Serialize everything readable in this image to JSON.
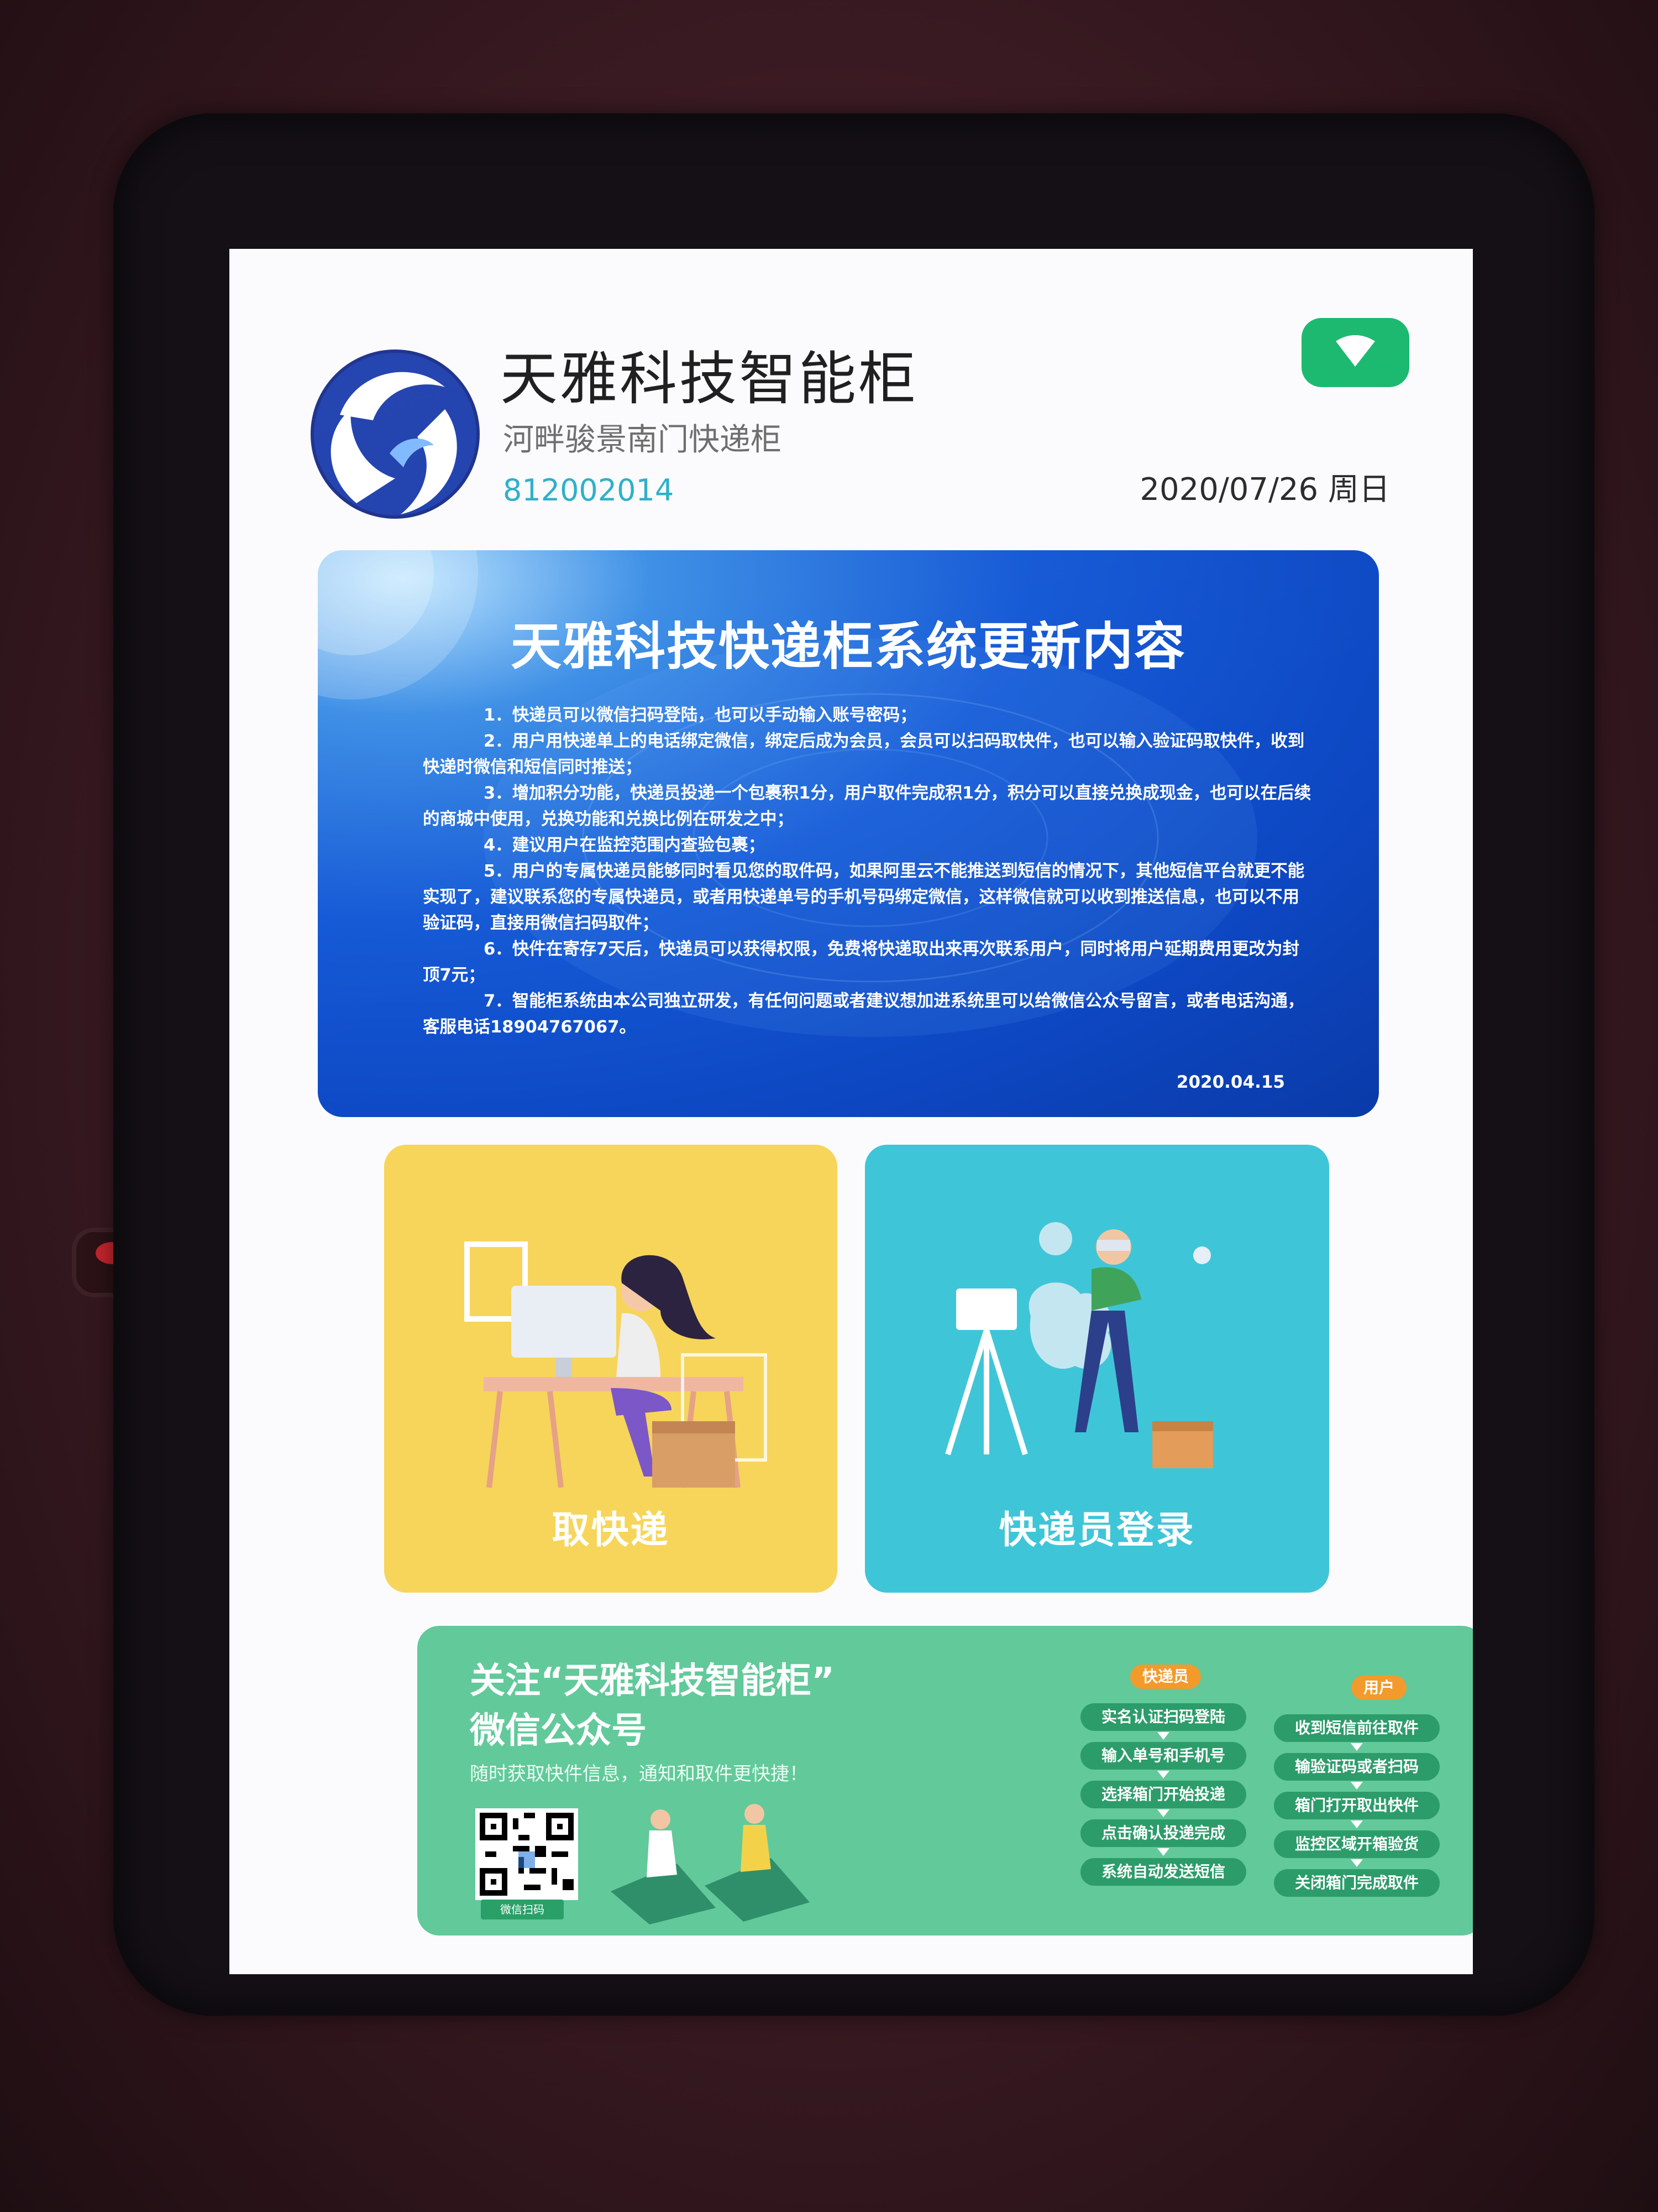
{
  "header": {
    "brand_title": "天雅科技智能柜",
    "location": "河畔骏景南门快递柜",
    "cabinet_id": "812002014",
    "date": "2020/07/26 周日",
    "logo_icon": "dolphin-swirl-logo",
    "status_icon": "wifi-icon",
    "status_color": "#19b86e"
  },
  "notice": {
    "title": "天雅科技快递柜系统更新内容",
    "items": [
      "1．快递员可以微信扫码登陆，也可以手动输入账号密码；",
      "2．用户用快递单上的电话绑定微信，绑定后成为会员，会员可以扫码取快件，也可以输入验证码取快件，收到快递时微信和短信同时推送；",
      "3．增加积分功能，快递员投递一个包裹积1分，用户取件完成积1分，积分可以直接兑换成现金，也可以在后续的商城中使用，兑换功能和兑换比例在研发之中；",
      "4．建议用户在监控范围内查验包裹；",
      "5．用户的专属快递员能够同时看见您的取件码，如果阿里云不能推送到短信的情况下，其他短信平台就更不能实现了，建议联系您的专属快递员，或者用快递单号的手机号码绑定微信，这样微信就可以收到推送信息，也可以不用验证码，直接用微信扫码取件；",
      "6．快件在寄存7天后，快递员可以获得权限，免费将快递取出来再次联系用户，同时将用户延期费用更改为封顶7元；",
      "7．智能柜系统由本公司独立研发，有任何问题或者建议想加进系统里可以给微信公众号留言，或者电话沟通，客服电话18904767067。"
    ],
    "date": "2020.04.15"
  },
  "tiles": {
    "pickup_label": "取快递",
    "courier_label": "快递员登录",
    "pickup_color": "#f6d55a",
    "courier_color": "#3fc5d8"
  },
  "follow": {
    "title_line1": "关注“天雅科技智能柜”",
    "title_line2": "微信公众号",
    "subtitle": "随时获取快件信息，通知和取件更快捷！",
    "qr_caption": "微信扫码",
    "courier_head": "快递员",
    "courier_steps": [
      "实名认证扫码登陆",
      "输入单号和手机号",
      "选择箱门开始投递",
      "点击确认投递完成",
      "系统自动发送短信"
    ],
    "user_head": "用户",
    "user_steps": [
      "收到短信前往取件",
      "输验证码或者扫码",
      "箱门打开取出快件",
      "监控区域开箱验货",
      "关闭箱门完成取件"
    ]
  }
}
